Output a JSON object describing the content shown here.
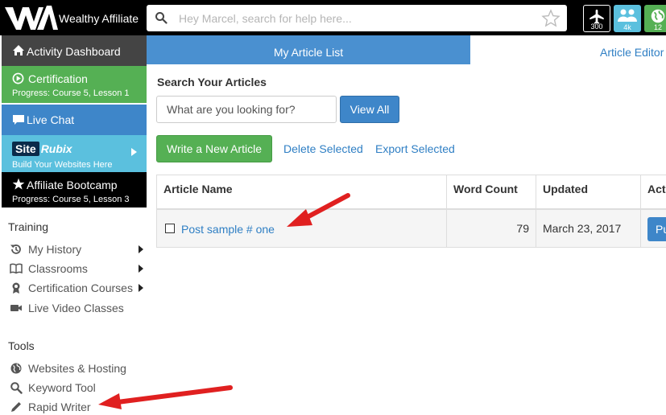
{
  "topbar": {
    "brand": "Wealthy Affiliate",
    "search_placeholder": "Hey Marcel, search for help here...",
    "badges": [
      {
        "icon": "airplane-icon",
        "count": "300",
        "color": "#000000"
      },
      {
        "icon": "users-icon",
        "count": "4k",
        "color": "#5bc0de"
      },
      {
        "icon": "globe-icon",
        "count": "12",
        "color": "#55b054"
      }
    ]
  },
  "sidebar": {
    "items": [
      {
        "label": "Activity Dashboard",
        "icon": "home-icon",
        "color": "#444444"
      },
      {
        "label": "Certification",
        "sub": "Progress: Course 5, Lesson 1",
        "icon": "play-circle-icon",
        "color": "#55b054"
      },
      {
        "label": "Live Chat",
        "icon": "chat-bubble-icon",
        "color": "#3e86c9"
      },
      {
        "label_site": "Site",
        "label_rubix": "Rubix",
        "sub": "Build Your Websites Here",
        "icon": "siterubix-logo",
        "color": "#5bc0de"
      },
      {
        "label": "Affiliate Bootcamp",
        "sub": "Progress: Course 5, Lesson 3",
        "icon": "star-icon",
        "color": "#000000"
      }
    ],
    "training": {
      "heading": "Training",
      "items": [
        {
          "label": "My History",
          "icon": "history-icon"
        },
        {
          "label": "Classrooms",
          "icon": "book-icon"
        },
        {
          "label": "Certification Courses",
          "icon": "certificate-icon"
        },
        {
          "label": "Live Video Classes",
          "icon": "video-camera-icon"
        }
      ]
    },
    "tools": {
      "heading": "Tools",
      "items": [
        {
          "label": "Websites & Hosting",
          "icon": "globe-icon"
        },
        {
          "label": "Keyword Tool",
          "icon": "search-icon"
        },
        {
          "label": "Rapid Writer",
          "icon": "pencil-icon"
        }
      ]
    }
  },
  "tabs": [
    {
      "label": "My Article List",
      "active": true
    },
    {
      "label": "Article Editor",
      "active": false
    }
  ],
  "main": {
    "search_heading": "Search Your Articles",
    "search_placeholder": "What are you looking for?",
    "view_all": "View All",
    "write_new": "Write a New Article",
    "delete_selected": "Delete Selected",
    "export_selected": "Export Selected"
  },
  "table": {
    "columns": [
      "Article Name",
      "Word Count",
      "Updated",
      "Actions"
    ],
    "rows": [
      {
        "name": "Post sample # one",
        "word_count": "79",
        "updated": "March 23, 2017",
        "action": "Publish"
      }
    ]
  },
  "colors": {
    "accent_blue": "#3e86c9",
    "tab_blue": "#4a90d0",
    "link_blue": "#2f7fc4",
    "green": "#55b054",
    "annotation_red": "#e02020"
  }
}
